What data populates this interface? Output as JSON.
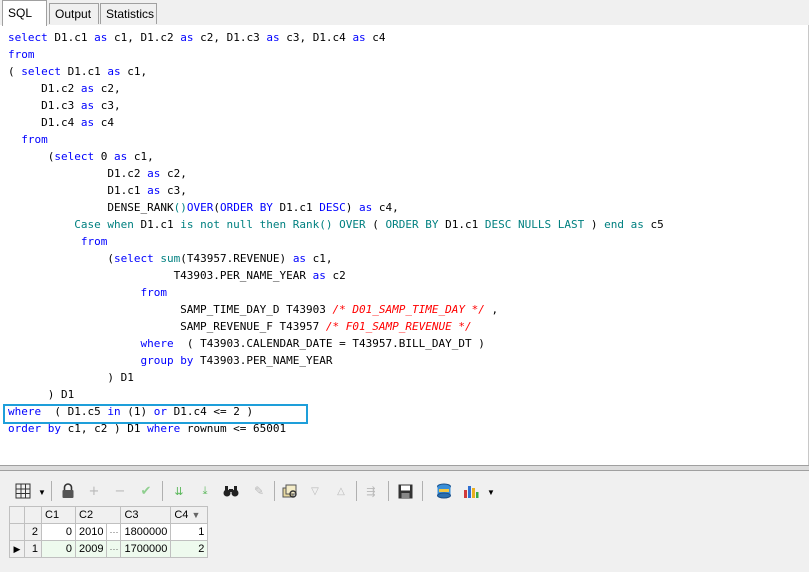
{
  "tabs": [
    {
      "label": "SQL",
      "active": true
    },
    {
      "label": "Output",
      "active": false
    },
    {
      "label": "Statistics",
      "active": false
    }
  ],
  "sql_lines": [
    [
      {
        "t": "select",
        "c": "kw"
      },
      {
        "t": " D1.c1 "
      },
      {
        "t": "as",
        "c": "kw"
      },
      {
        "t": " c1, D1.c2 "
      },
      {
        "t": "as",
        "c": "kw"
      },
      {
        "t": " c2, D1.c3 "
      },
      {
        "t": "as",
        "c": "kw"
      },
      {
        "t": " c3, D1.c4 "
      },
      {
        "t": "as",
        "c": "kw"
      },
      {
        "t": " c4"
      }
    ],
    [
      {
        "t": "from",
        "c": "kw"
      }
    ],
    [
      {
        "t": "( "
      },
      {
        "t": "select",
        "c": "kw"
      },
      {
        "t": " D1.c1 "
      },
      {
        "t": "as",
        "c": "kw"
      },
      {
        "t": " c1,"
      }
    ],
    [
      {
        "t": "     D1.c2 "
      },
      {
        "t": "as",
        "c": "kw"
      },
      {
        "t": " c2,"
      }
    ],
    [
      {
        "t": "     D1.c3 "
      },
      {
        "t": "as",
        "c": "kw"
      },
      {
        "t": " c3,"
      }
    ],
    [
      {
        "t": "     D1.c4 "
      },
      {
        "t": "as",
        "c": "kw"
      },
      {
        "t": " c4"
      }
    ],
    [
      {
        "t": "  "
      },
      {
        "t": "from",
        "c": "kw"
      }
    ],
    [
      {
        "t": "      ("
      },
      {
        "t": "select",
        "c": "kw"
      },
      {
        "t": " 0 "
      },
      {
        "t": "as",
        "c": "kw"
      },
      {
        "t": " c1,"
      }
    ],
    [
      {
        "t": "               D1.c2 "
      },
      {
        "t": "as",
        "c": "kw"
      },
      {
        "t": " c2,"
      }
    ],
    [
      {
        "t": "               D1.c1 "
      },
      {
        "t": "as",
        "c": "kw"
      },
      {
        "t": " c3,"
      }
    ],
    [
      {
        "t": "               DENSE_RANK"
      },
      {
        "t": "()",
        "c": "fn"
      },
      {
        "t": "OVER",
        "c": "kw"
      },
      {
        "t": "("
      },
      {
        "t": "ORDER BY",
        "c": "kw"
      },
      {
        "t": " D1.c1 "
      },
      {
        "t": "DESC",
        "c": "kw"
      },
      {
        "t": ") "
      },
      {
        "t": "as",
        "c": "kw"
      },
      {
        "t": " c4,"
      }
    ],
    [
      {
        "t": "          "
      },
      {
        "t": "Case when",
        "c": "fn"
      },
      {
        "t": " D1.c1 "
      },
      {
        "t": "is not null then",
        "c": "fn"
      },
      {
        "t": " "
      },
      {
        "t": "Rank()",
        "c": "fn"
      },
      {
        "t": " "
      },
      {
        "t": "OVER",
        "c": "fn"
      },
      {
        "t": " ( "
      },
      {
        "t": "ORDER BY",
        "c": "fn"
      },
      {
        "t": " D1.c1 "
      },
      {
        "t": "DESC NULLS LAST",
        "c": "fn"
      },
      {
        "t": " ) "
      },
      {
        "t": "end as",
        "c": "fn"
      },
      {
        "t": " c5"
      }
    ],
    [
      {
        "t": "           "
      },
      {
        "t": "from",
        "c": "kw"
      }
    ],
    [
      {
        "t": "               ("
      },
      {
        "t": "select",
        "c": "kw"
      },
      {
        "t": " "
      },
      {
        "t": "sum",
        "c": "fn"
      },
      {
        "t": "(T43957.REVENUE) "
      },
      {
        "t": "as",
        "c": "kw"
      },
      {
        "t": " c1,"
      }
    ],
    [
      {
        "t": "                         T43903.PER_NAME_YEAR "
      },
      {
        "t": "as",
        "c": "kw"
      },
      {
        "t": " c2"
      }
    ],
    [
      {
        "t": "                    "
      },
      {
        "t": "from",
        "c": "kw"
      }
    ],
    [
      {
        "t": "                          SAMP_TIME_DAY_D T43903 "
      },
      {
        "t": "/* D01_SAMP_TIME_DAY */",
        "c": "cm"
      },
      {
        "t": " ,"
      }
    ],
    [
      {
        "t": "                          SAMP_REVENUE_F T43957 "
      },
      {
        "t": "/* F01_SAMP_REVENUE */",
        "c": "cm"
      }
    ],
    [
      {
        "t": "                    "
      },
      {
        "t": "where",
        "c": "kw"
      },
      {
        "t": "  ( T43903.CALENDAR_DATE = T43957.BILL_DAY_DT )"
      }
    ],
    [
      {
        "t": "                    "
      },
      {
        "t": "group by",
        "c": "kw"
      },
      {
        "t": " T43903.PER_NAME_YEAR"
      }
    ],
    [
      {
        "t": "               ) D1"
      }
    ],
    [
      {
        "t": "      ) D1"
      }
    ],
    [
      {
        "t": "where",
        "c": "kw"
      },
      {
        "t": "  ( D1.c5 "
      },
      {
        "t": "in",
        "c": "kw"
      },
      {
        "t": " (1) "
      },
      {
        "t": "or",
        "c": "kw"
      },
      {
        "t": " D1.c4 <= 2 )"
      }
    ],
    [
      {
        "t": "order by",
        "c": "kw"
      },
      {
        "t": " c1, c2 ) D1 "
      },
      {
        "t": "where",
        "c": "kw"
      },
      {
        "t": " rownum <= 65001"
      }
    ]
  ],
  "toolbar": {
    "icons": [
      "grid-view-icon",
      "lock-icon",
      "add-record-icon",
      "delete-record-icon",
      "post-edit-icon",
      "fetch-next-icon",
      "fetch-last-icon",
      "find-icon",
      "clear-icon",
      "query-by-example-icon",
      "sort-descending-icon",
      "sort-ascending-icon",
      "export-icon",
      "save-icon",
      "record-viewer-icon",
      "chart-icon"
    ]
  },
  "results": {
    "columns": [
      "C1",
      "C2",
      "C3",
      "C4"
    ],
    "sort_indicator": "▼",
    "ellipsis": "···",
    "current_row_marker": "▶",
    "rows": [
      {
        "rownum": "2",
        "c1": "0",
        "c2": "2010",
        "c3": "1800000",
        "c4": "1",
        "current": false
      },
      {
        "rownum": "1",
        "c1": "0",
        "c2": "2009",
        "c3": "1700000",
        "c4": "2",
        "current": true
      }
    ]
  },
  "colors": {
    "keyword": "#0000ff",
    "function": "#008080",
    "comment": "#ff0000",
    "highlight_border": "#1e9fda"
  }
}
